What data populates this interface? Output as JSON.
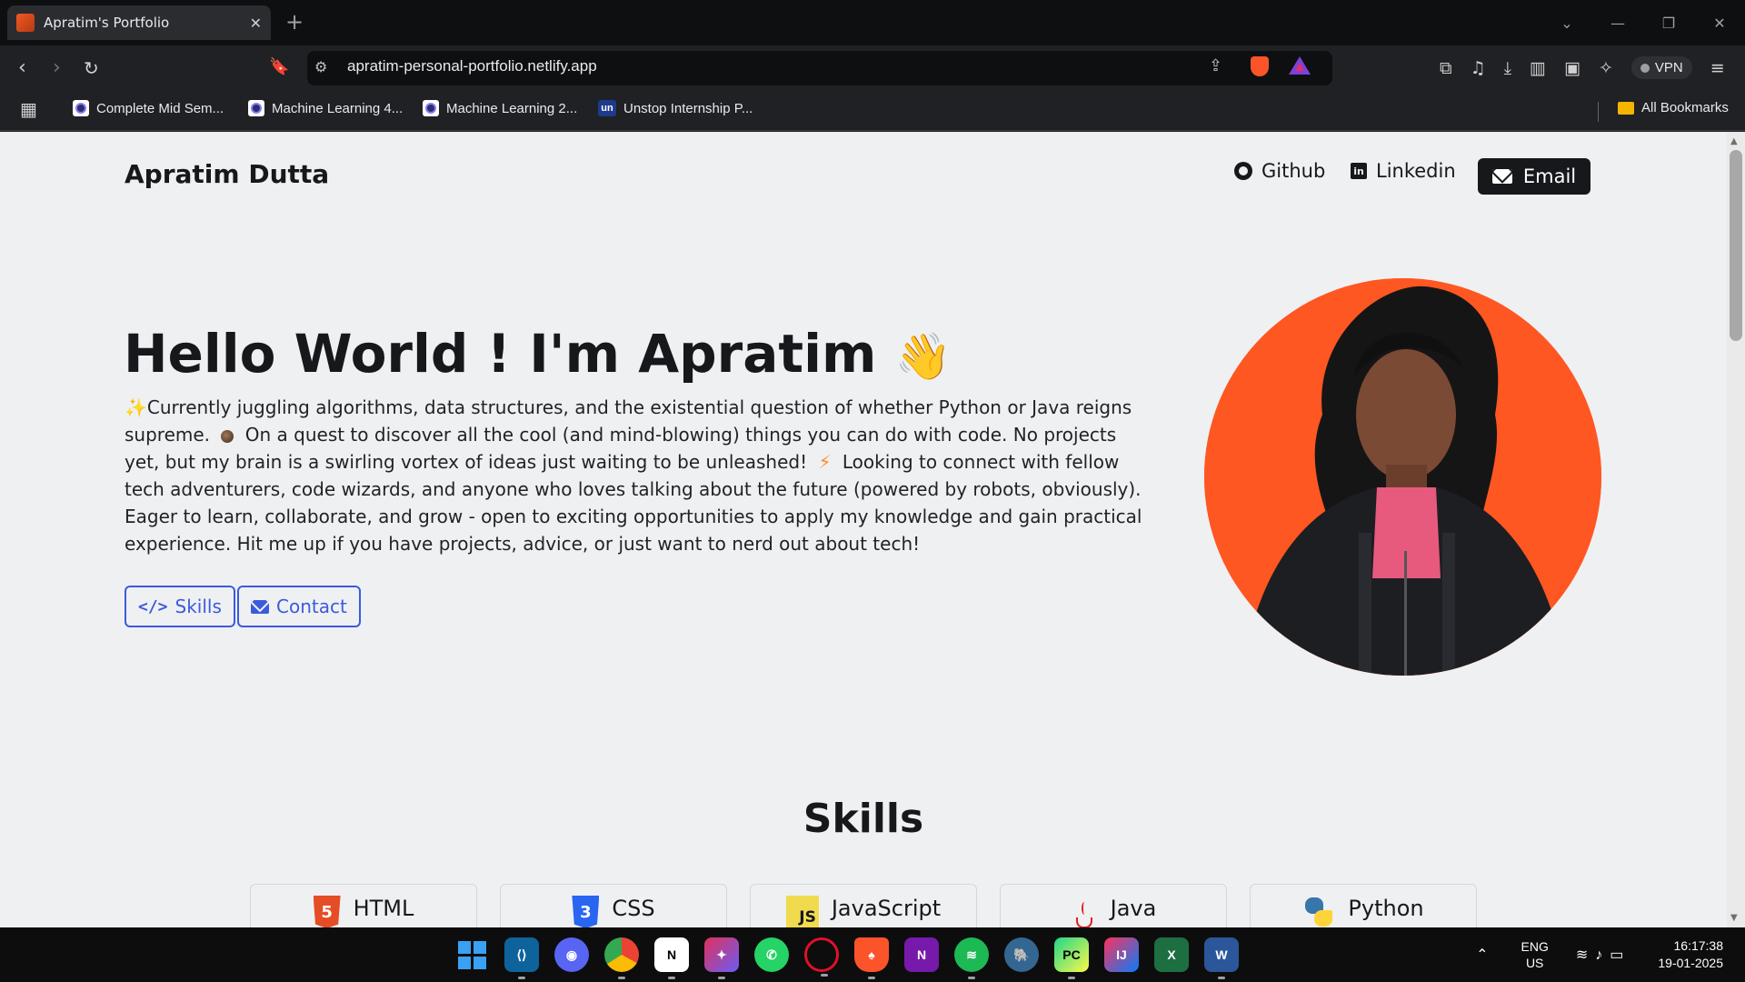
{
  "browser": {
    "tab_title": "Apratim's Portfolio",
    "url": "apratim-personal-portfolio.netlify.app",
    "vpn_label": "VPN",
    "bookmarks": [
      {
        "label": "Complete Mid Sem...",
        "icon": "academy-icon"
      },
      {
        "label": "Machine Learning 4...",
        "icon": "academy-icon"
      },
      {
        "label": "Machine Learning 2...",
        "icon": "academy-icon"
      },
      {
        "label": "Unstop Internship P...",
        "icon": "unstop-icon"
      }
    ],
    "all_bookmarks_label": "All Bookmarks"
  },
  "nav": {
    "brand": "Apratim Dutta",
    "github_label": "Github",
    "linkedin_label": "Linkedin",
    "email_label": "Email"
  },
  "hero": {
    "title": "Hello World ! I'm Apratim",
    "title_emoji": "👋",
    "intro_sparkle": "✨",
    "bio_part1": "Currently juggling algorithms, data structures, and the existential question of whether Python or Java reigns supreme.",
    "bio_part2": "On a quest to discover all the cool (and mind-blowing) things you can do with code. No projects yet, but my brain is a swirling vortex of ideas just waiting to be unleashed!",
    "bio_part3": "Looking to connect with fellow tech adventurers, code wizards, and anyone who loves talking about the future (powered by robots, obviously). Eager to learn, collaborate, and grow - open to exciting opportunities to apply my knowledge and gain practical experience. Hit me up if you have projects, advice, or just want to nerd out about tech!",
    "bolt_emoji": "⚡",
    "skills_button": "Skills",
    "contact_button": "Contact"
  },
  "skills": {
    "title": "Skills",
    "items": [
      {
        "label": "HTML",
        "icon": "html5-icon"
      },
      {
        "label": "CSS",
        "icon": "css3-icon"
      },
      {
        "label": "JavaScript",
        "icon": "javascript-icon"
      },
      {
        "label": "Java",
        "icon": "java-icon"
      },
      {
        "label": "Python",
        "icon": "python-icon"
      }
    ]
  },
  "taskbar": {
    "lang_line1": "ENG",
    "lang_line2": "US",
    "time": "16:17:38",
    "date": "19-01-2025"
  },
  "colors": {
    "accent_blue": "#3b5bdb",
    "avatar_bg": "#ff5722",
    "page_bg": "#eff0f2",
    "dark": "#16181b"
  }
}
